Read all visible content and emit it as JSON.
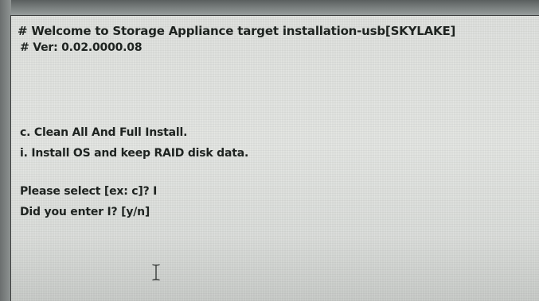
{
  "console": {
    "lines": {
      "welcome": "# Welcome to Storage Appliance target installation-usb[SKYLAKE]",
      "version": "# Ver: 0.02.0000.08",
      "option_c": "c. Clean All And Full Install.",
      "option_i": "i.  Install OS and keep RAID disk data.",
      "prompt_select": "Please select [ex: c]? I",
      "prompt_confirm": "Did you enter I? [y/n]"
    }
  },
  "icons": {
    "mouse_cursor": "i-beam-cursor-icon"
  },
  "colors": {
    "screen_background": "#e0e2df",
    "text": "#1e2320",
    "bezel": "#7f8584"
  }
}
